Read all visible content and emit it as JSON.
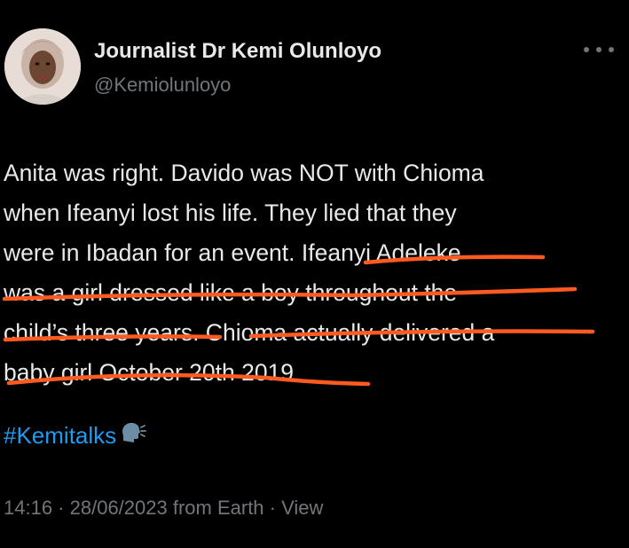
{
  "author": {
    "display_name": "Journalist Dr Kemi Olunloyo",
    "handle": "@Kemiolunloyo"
  },
  "tweet": {
    "lines": [
      "Anita was right. Davido was NOT with Chioma",
      "when Ifeanyi lost his life. They lied that they",
      "were in Ibadan for an event.  Ifeanyi Adeleke",
      "was a girl dressed like a boy throughout the",
      "child’s three years. Chioma actually delivered a",
      "baby girl October 20th 2019"
    ],
    "hashtag": "#Kemitalks",
    "hashtag_icon": "speaking-head-icon"
  },
  "meta": {
    "time": "14:16",
    "separator": " · ",
    "date": "28/06/2023",
    "source": " from Earth",
    "separator2": " · ",
    "views_label": "View"
  },
  "colors": {
    "background": "#000000",
    "text": "#e7e9ea",
    "secondary": "#71767b",
    "link": "#1d9bf0",
    "underline_annotation": "#ff5a1f"
  },
  "icons": {
    "more": "more-options-icon"
  }
}
